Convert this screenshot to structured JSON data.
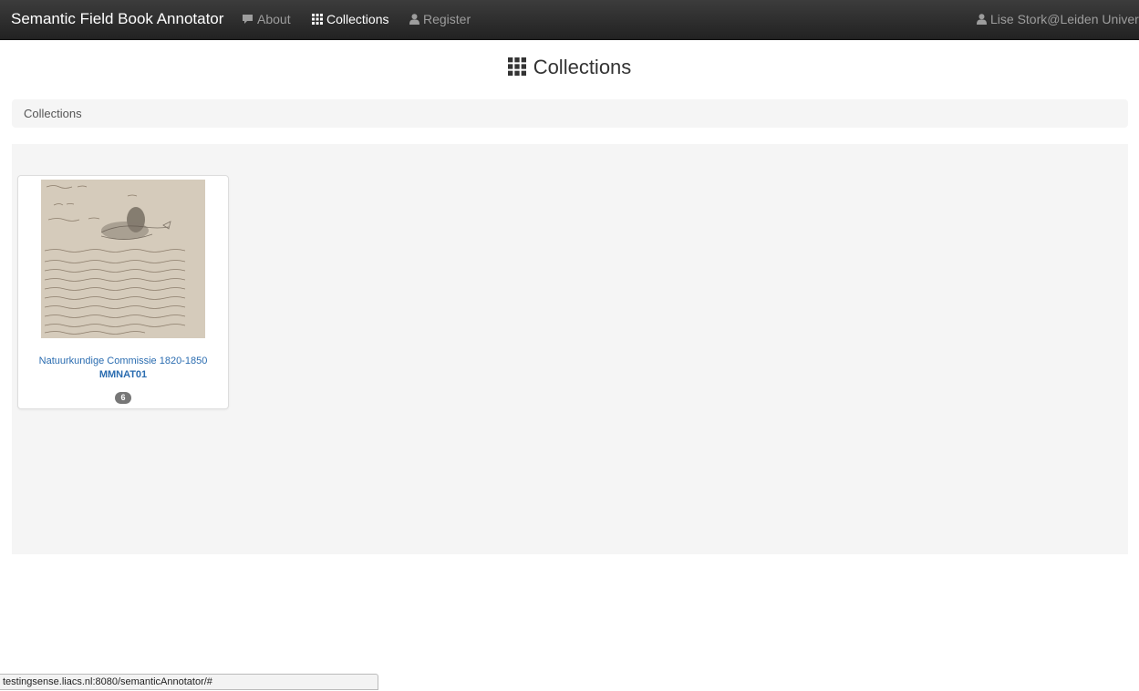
{
  "navbar": {
    "brand": "Semantic Field Book Annotator",
    "items": [
      {
        "label": "About",
        "icon": "comment-icon"
      },
      {
        "label": "Collections",
        "icon": "grid-icon",
        "active": true
      },
      {
        "label": "Register",
        "icon": "user-icon"
      }
    ],
    "user": {
      "label": "Lise Stork@Leiden University",
      "icon": "user-icon"
    }
  },
  "page": {
    "title": "Collections",
    "title_icon": "grid-icon"
  },
  "breadcrumb": {
    "label": "Collections"
  },
  "collections": [
    {
      "title": "Natuurkundige Commissie 1820-1850",
      "code": "MMNAT01",
      "count": "6",
      "thumbnail": "field-book-page-with-fish-sketch"
    }
  ],
  "status_bar": {
    "url": "testingsense.liacs.nl:8080/semanticAnnotator/#"
  },
  "colors": {
    "navbar_bg": "#222222",
    "link": "#2a6cb0",
    "badge_bg": "#777777",
    "well_bg": "#f5f5f5"
  }
}
